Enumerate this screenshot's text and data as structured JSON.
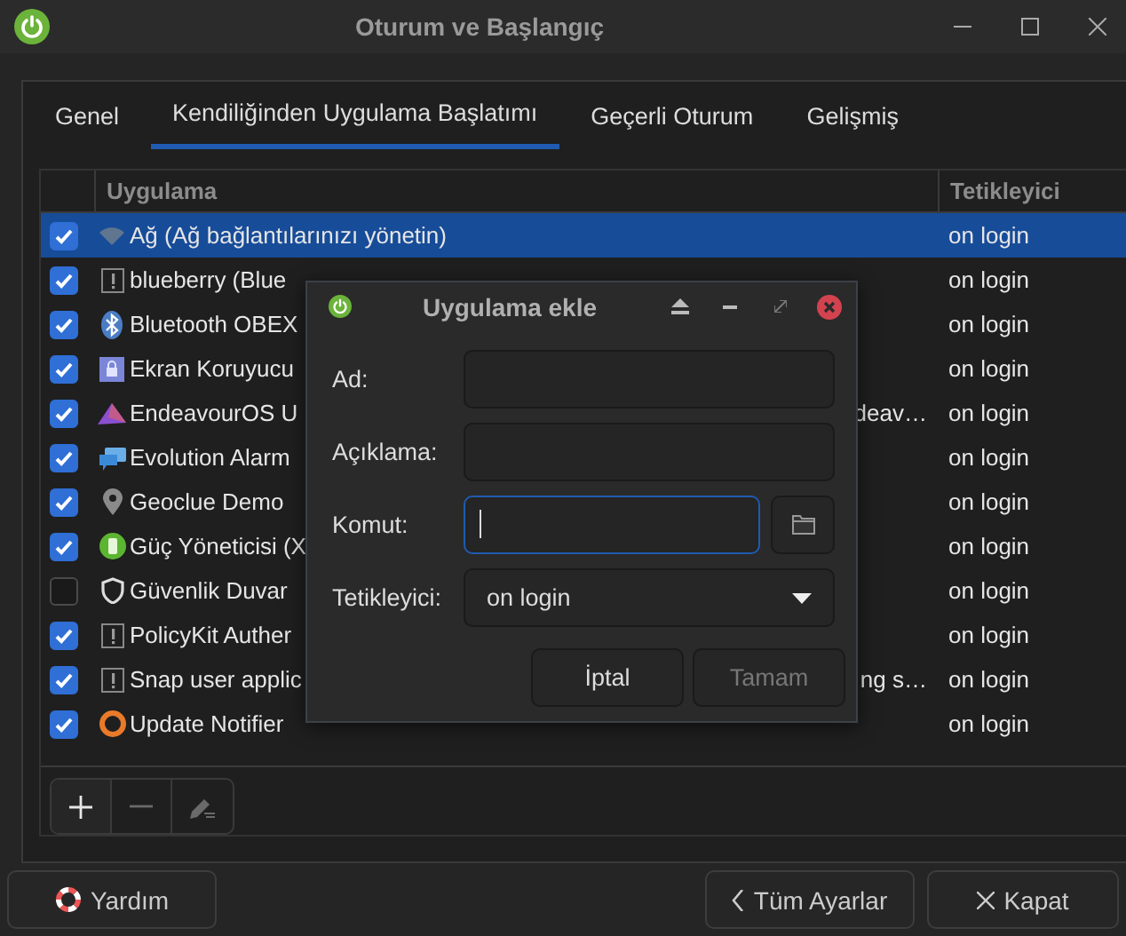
{
  "window": {
    "title": "Oturum ve Başlangıç"
  },
  "tabs": [
    {
      "label": "Genel",
      "selected": false
    },
    {
      "label": "Kendiliğinden Uygulama Başlatımı",
      "selected": true
    },
    {
      "label": "Geçerli Oturum",
      "selected": false
    },
    {
      "label": "Gelişmiş",
      "selected": false
    }
  ],
  "table": {
    "columns": [
      "Uygulama",
      "Tetikleyici"
    ],
    "rows": [
      {
        "checked": true,
        "selected": true,
        "name": "Ağ (Ağ bağlantılarınızı yönetin)",
        "trigger": "on login"
      },
      {
        "checked": true,
        "selected": false,
        "name": "blueberry (Blue",
        "trigger": "on login"
      },
      {
        "checked": true,
        "selected": false,
        "name": "Bluetooth OBEX",
        "trigger": "on login"
      },
      {
        "checked": true,
        "selected": false,
        "name": "Ekran Koruyucu",
        "trigger": "on login"
      },
      {
        "checked": true,
        "selected": false,
        "name": "EndeavourOS U",
        "name_end": "deav…",
        "trigger": "on login"
      },
      {
        "checked": true,
        "selected": false,
        "name": "Evolution Alarm",
        "trigger": "on login"
      },
      {
        "checked": true,
        "selected": false,
        "name": "Geoclue Demo",
        "trigger": "on login"
      },
      {
        "checked": true,
        "selected": false,
        "name": "Güç Yöneticisi (X",
        "trigger": "on login"
      },
      {
        "checked": false,
        "selected": false,
        "name": "Güvenlik Duvar",
        "trigger": "on login"
      },
      {
        "checked": true,
        "selected": false,
        "name": "PolicyKit Auther",
        "trigger": "on login"
      },
      {
        "checked": true,
        "selected": false,
        "name": "Snap user applic",
        "name_end": "ng s…",
        "trigger": "on login"
      },
      {
        "checked": true,
        "selected": false,
        "name": "Update Notifier",
        "trigger": "on login"
      }
    ]
  },
  "toolbar": [
    {
      "kind": "add",
      "disabled": false
    },
    {
      "kind": "remove",
      "disabled": true
    },
    {
      "kind": "edit",
      "disabled": true
    }
  ],
  "dialog": {
    "title": "Uygulama ekle",
    "fields": [
      {
        "kind": "text",
        "label": "Ad:",
        "focused": false
      },
      {
        "kind": "text",
        "label": "Açıklama:",
        "focused": false
      },
      {
        "kind": "command",
        "label": "Komut:",
        "focused": true
      },
      {
        "kind": "select",
        "label": "Tetikleyici:",
        "value": "on login"
      }
    ],
    "buttons": [
      {
        "label": "İptal",
        "disabled": false
      },
      {
        "label": "Tamam",
        "disabled": true
      }
    ]
  },
  "footer": {
    "help": "Yardım",
    "back": "Tüm Ayarlar",
    "close": "Kapat"
  }
}
